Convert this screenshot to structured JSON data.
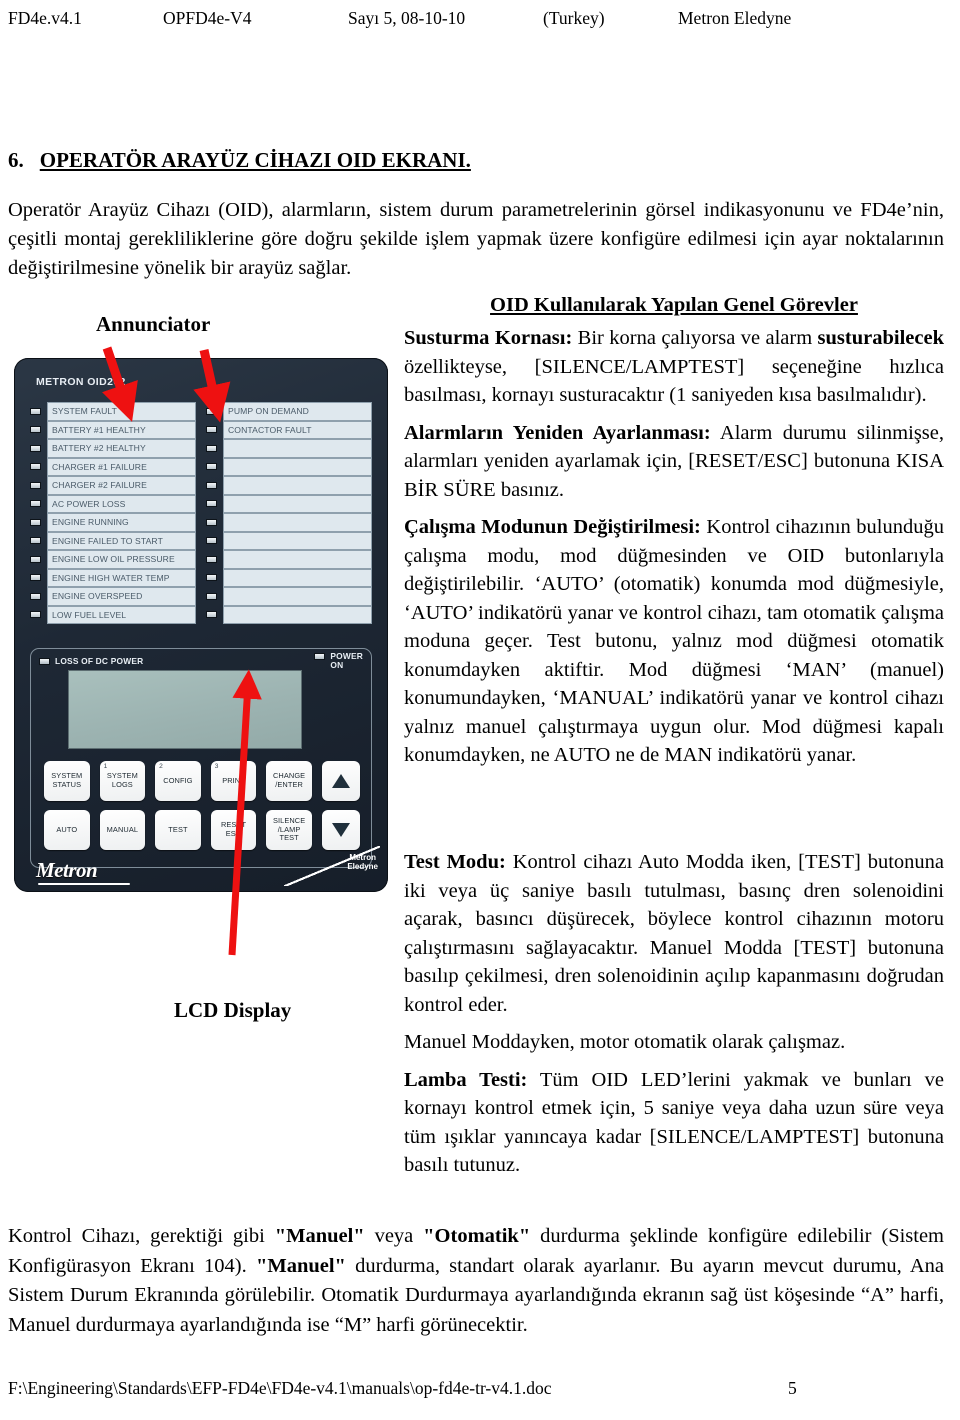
{
  "header": {
    "doc_code": "FD4e.v4.1",
    "doc_ref": "OPFD4e-V4",
    "issue": "Sayı 5, 08-10-10",
    "country": "(Turkey)",
    "company": "Metron Eledyne"
  },
  "section": {
    "number": "6.",
    "title": "OPERATÖR ARAYÜZ CİHAZI OID EKRANI.",
    "intro": "Operatör Arayüz Cihazı (OID), alarmların, sistem durum parametrelerinin görsel indikasyonunu ve FD4e’nin, çeşitli montaj gerekliliklerine göre doğru şekilde işlem yapmak üzere konfigüre edilmesi için ayar noktalarının değiştirilmesine yönelik bir arayüz sağlar."
  },
  "callouts": {
    "annunciator": "Annunciator",
    "lcd_display": "LCD Display"
  },
  "right_column": {
    "title": "OID Kullanılarak Yapılan Genel Görevler",
    "paragraphs": [
      {
        "lead": "Susturma Kornası:",
        "lead2": "",
        "body": " Bir korna çalıyorsa ve alarm <b>susturabilecek</b> özellikteyse, [SILENCE/LAMPTEST] seçeneğine hızlıca basılması, kornayı susturacaktır (1 saniyeden kısa basılmalıdır)."
      },
      {
        "lead": "Alarmların Yeniden Ayarlanması:",
        "body": " Alarm durumu silinmişse, alarmları yeniden ayarlamak için, [RESET/ESC] butonuna KISA BİR SÜRE basınız."
      },
      {
        "lead": "Çalışma Modunun Değiştirilmesi:",
        "body": " Kontrol cihazının bulunduğu çalışma modu, mod düğmesinden ve OID butonlarıyla değiştirilebilir. ‘AUTO’ (otomatik) konumda mod düğmesiyle, ‘AUTO’ indikatörü yanar ve kontrol cihazı, tam otomatik çalışma moduna geçer. Test butonu, yalnız mod düğmesi otomatik konumdayken aktiftir. Mod düğmesi ‘MAN’ (manuel) konumundayken, ‘MANUAL’ indikatörü yanar ve kontrol cihazı yalnız manuel çalıştırmaya uygun olur. Mod düğmesi kapalı konumdayken, ne AUTO ne de MAN indikatörü yanar."
      }
    ],
    "lower_paragraphs": [
      {
        "lead": "Test Modu:",
        "body": " Kontrol cihazı Auto Modda iken, [TEST] butonuna iki veya üç saniye basılı tutulması, basınç dren solenoidini açarak, basıncı düşürecek, böylece kontrol cihazının motoru çalıştırmasını sağlayacaktır. Manuel Modda [TEST] butonuna basılıp çekilmesi, dren solenoidinin açılıp kapanmasını doğrudan kontrol eder."
      },
      {
        "lead": "",
        "body": "Manuel Moddayken, motor otomatik olarak çalışmaz."
      },
      {
        "lead": "Lamba Testi:",
        "body": " Tüm OID LED’lerini yakmak ve bunları ve kornayı kontrol etmek için, 5 saniye veya daha uzun süre veya tüm ışıklar yanıncaya kadar [SILENCE/LAMPTEST] butonuna basılı tutunuz."
      }
    ]
  },
  "bottom_paragraph": "Kontrol Cihazı, gerektiği gibi <b>\"Manuel\"</b> veya <b>\"Otomatik\"</b> durdurma şeklinde konfigüre edilebilir (Sistem Konfigürasyon Ekranı 104). <b>\"Manuel\"</b> durdurma, standart olarak ayarlanır. Bu ayarın mevcut durumu, Ana Sistem Durum Ekranında görülebilir. Otomatik Durdurmaya ayarlandığında ekranın sağ üst köşesinde “A” harfi, Manuel durdurmaya ayarlandığında ise “M” harfi görünecektir.",
  "footer": {
    "path": "F:\\Engineering\\Standards\\EFP-FD4e\\FD4e-v4.1\\manuals\\op-fd4e-tr-v4.1.doc",
    "page": "5"
  },
  "device": {
    "model_label": "METRON OID202",
    "annunciator_left": [
      "SYSTEM FAULT",
      "BATTERY #1 HEALTHY",
      "BATTERY #2 HEALTHY",
      "CHARGER #1 FAILURE",
      "CHARGER #2 FAILURE",
      "AC POWER LOSS",
      "ENGINE RUNNING",
      "ENGINE FAILED TO START",
      "ENGINE LOW OIL PRESSURE",
      "ENGINE HIGH WATER TEMP",
      "ENGINE OVERSPEED",
      "LOW FUEL LEVEL"
    ],
    "annunciator_right": [
      "PUMP ON DEMAND",
      "CONTACTOR FAULT",
      "",
      "",
      "",
      "",
      "",
      "",
      "",
      "",
      "",
      ""
    ],
    "loss_of_dc_power": "LOSS OF DC POWER",
    "power_on_line1": "POWER",
    "power_on_line2": "ON",
    "keys_row1": [
      {
        "num": "",
        "label": "SYSTEM\nSTATUS"
      },
      {
        "num": "1",
        "label": "SYSTEM\nLOGS"
      },
      {
        "num": "2",
        "label": "CONFIG"
      },
      {
        "num": "3",
        "label": "PRINT"
      },
      {
        "num": "",
        "label": "CHANGE\n/ENTER"
      }
    ],
    "keys_row2": [
      {
        "num": "",
        "label": "AUTO"
      },
      {
        "num": "",
        "label": "MANUAL"
      },
      {
        "num": "",
        "label": "TEST"
      },
      {
        "num": "",
        "label": "RESET\nESC"
      },
      {
        "num": "",
        "label": "SILENCE\n/LAMP\nTEST"
      }
    ],
    "arrow_up_label": "up-arrow-key",
    "arrow_down_label": "down-arrow-key",
    "brand_primary": "Metron",
    "brand_corner_line1": "Metron",
    "brand_corner_line2": "Eledyne"
  },
  "colors": {
    "arrow_red": "#ee1111",
    "device_body": "#1e2835",
    "lcd": "#9db5b3",
    "annunciator_window": "#dfe8ee"
  }
}
